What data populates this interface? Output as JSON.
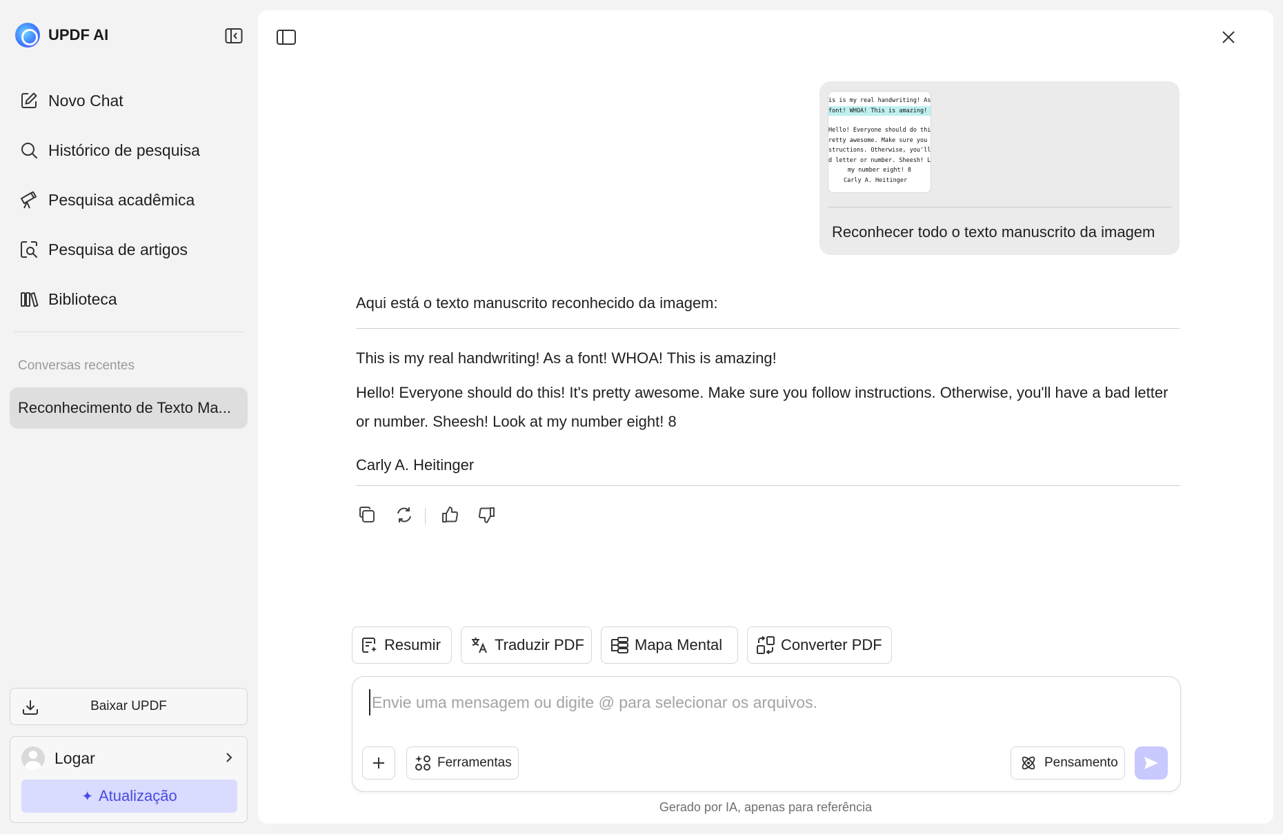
{
  "sidebar": {
    "brand": "UPDF AI",
    "nav": [
      {
        "label": "Novo Chat",
        "icon": "edit-icon"
      },
      {
        "label": "Histórico de pesquisa",
        "icon": "search-icon"
      },
      {
        "label": "Pesquisa acadêmica",
        "icon": "telescope-icon"
      },
      {
        "label": "Pesquisa de artigos",
        "icon": "document-search-icon"
      },
      {
        "label": "Biblioteca",
        "icon": "library-icon"
      }
    ],
    "recent_title": "Conversas recentes",
    "recent_items": [
      "Reconhecimento de Texto Ma..."
    ],
    "download_label": "Baixar UPDF",
    "login_label": "Logar",
    "upgrade_label": "Atualização"
  },
  "chat": {
    "user_message": {
      "text": "Reconhecer todo o texto manuscrito da imagem",
      "thumbnail_lines": [
        "is is my real handwriting! As a",
        "font! WHOA! This is amazing!",
        "",
        "Hello! Everyone should do this! It's",
        "retty awesome. Make sure you follo",
        "structions. Otherwise, you'll have a",
        "d letter or number. Sheesh! Look a",
        "my number eight! 8",
        "Carly A. Heitinger"
      ]
    },
    "assistant_message": {
      "intro": "Aqui está o texto manuscrito reconhecido da imagem:",
      "paragraphs": [
        "This is my real handwriting! As a font! WHOA! This is amazing!",
        "Hello! Everyone should do this! It's pretty awesome. Make sure you follow instructions. Otherwise, you'll have a bad letter or number. Sheesh! Look at my number eight! 8",
        "Carly A. Heitinger"
      ]
    }
  },
  "quick_actions": [
    "Resumir",
    "Traduzir PDF",
    "Mapa Mental",
    "Converter PDF"
  ],
  "composer": {
    "placeholder": "Envie uma mensagem ou digite @ para selecionar os arquivos.",
    "value": "",
    "tools_label": "Ferramentas",
    "thinking_label": "Pensamento"
  },
  "footer_note": "Gerado por IA, apenas para referência",
  "colors": {
    "accent": "#4a4adf",
    "upgrade_bg": "#d9dbff",
    "send_bg": "#c7c9ff"
  }
}
